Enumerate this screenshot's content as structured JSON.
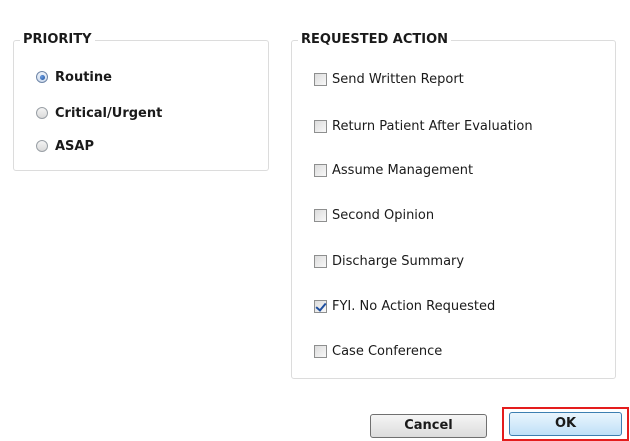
{
  "priority": {
    "title": "PRIORITY",
    "options": [
      {
        "label": "Routine",
        "selected": true
      },
      {
        "label": "Critical/Urgent",
        "selected": false
      },
      {
        "label": "ASAP",
        "selected": false
      }
    ]
  },
  "requested_action": {
    "title": "REQUESTED ACTION",
    "options": [
      {
        "label": "Send Written Report",
        "checked": false
      },
      {
        "label": "Return Patient After Evaluation",
        "checked": false
      },
      {
        "label": "Assume Management",
        "checked": false
      },
      {
        "label": "Second Opinion",
        "checked": false
      },
      {
        "label": "Discharge Summary",
        "checked": false
      },
      {
        "label": "FYI. No Action Requested",
        "checked": true
      },
      {
        "label": "Case Conference",
        "checked": false
      }
    ]
  },
  "buttons": {
    "cancel_label": "Cancel",
    "ok_label": "OK"
  },
  "colors": {
    "highlight": "#e41d1d",
    "check_accent": "#1e4fa0"
  }
}
